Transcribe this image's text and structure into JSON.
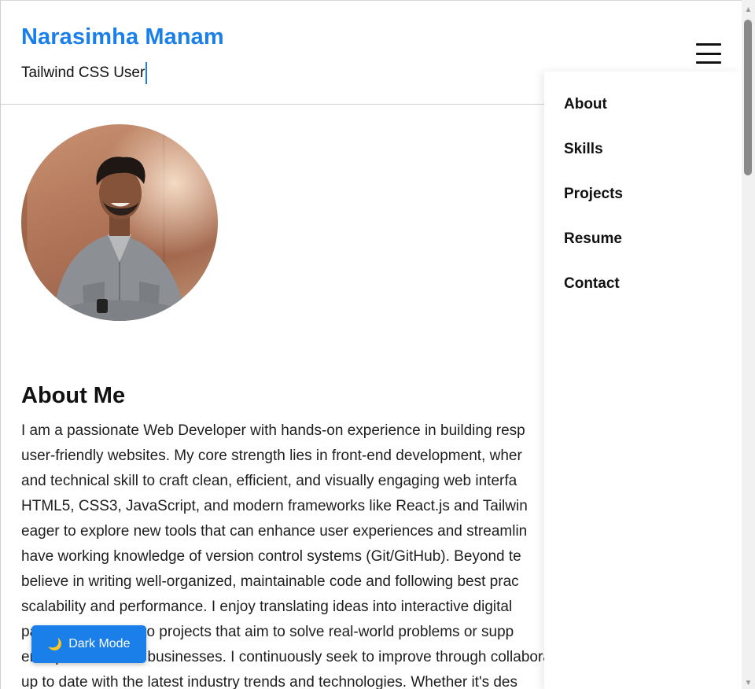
{
  "header": {
    "name": "Narasimha Manam",
    "tagline": "Tailwind CSS User"
  },
  "nav": {
    "items": [
      {
        "label": "About"
      },
      {
        "label": "Skills"
      },
      {
        "label": "Projects"
      },
      {
        "label": "Resume"
      },
      {
        "label": "Contact"
      }
    ]
  },
  "about": {
    "heading": "About Me",
    "lines": [
      "I am a passionate Web Developer with hands-on experience in building resp",
      "user-friendly websites. My core strength lies in front-end development, wher",
      "and technical skill to craft clean, efficient, and visually engaging web interfa",
      "HTML5, CSS3, JavaScript, and modern frameworks like React.js and Tailwin",
      "eager to explore new tools that can enhance user experiences and streamlin",
      "have working knowledge of version control systems (Git/GitHub). Beyond te",
      "believe in writing well-organized, maintainable code and following best prac",
      "scalability and performance. I enjoy translating ideas into interactive digital",
      "particularly drawn to projects that aim to solve real-world problems or supp",
      "entrepreneurs and businesses. I continuously seek to improve through collaboration",
      "up to date with the latest industry trends and technologies. Whether it's des"
    ]
  },
  "dark_mode_button": {
    "label": "Dark Mode",
    "icon": "moon-icon"
  },
  "icons": {
    "menu": "hamburger-menu-icon"
  },
  "colors": {
    "accent": "#1a7fe8",
    "text": "#111111"
  }
}
